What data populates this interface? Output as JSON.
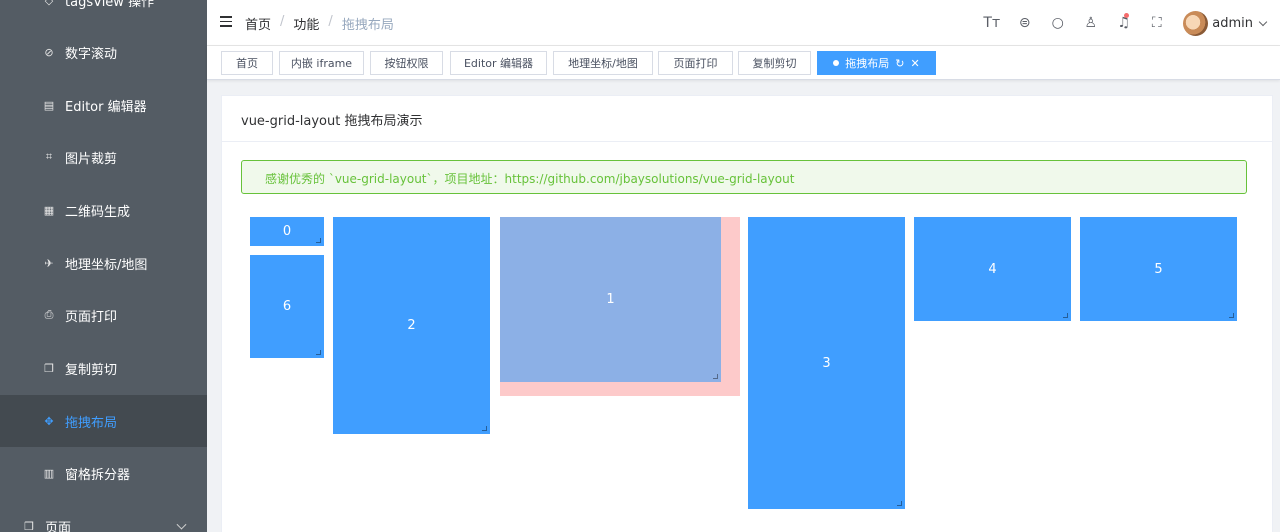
{
  "sidebar": {
    "items": [
      {
        "label": "tagsView 操作",
        "icon": "tag-icon"
      },
      {
        "label": "数字滚动",
        "icon": "gauge-icon"
      },
      {
        "label": "Editor 编辑器",
        "icon": "editor-icon"
      },
      {
        "label": "图片裁剪",
        "icon": "crop-icon"
      },
      {
        "label": "二维码生成",
        "icon": "qrcode-icon"
      },
      {
        "label": "地理坐标/地图",
        "icon": "map-icon"
      },
      {
        "label": "页面打印",
        "icon": "printer-icon"
      },
      {
        "label": "复制剪切",
        "icon": "copy-icon"
      },
      {
        "label": "拖拽布局",
        "icon": "drag-icon"
      },
      {
        "label": "窗格拆分器",
        "icon": "split-icon"
      },
      {
        "label": "页面",
        "icon": "page-icon"
      }
    ]
  },
  "navbar": {
    "breadcrumb": [
      "首页",
      "功能",
      "拖拽布局"
    ],
    "username": "admin"
  },
  "tags": [
    {
      "label": "首页"
    },
    {
      "label": "内嵌 iframe"
    },
    {
      "label": "按钮权限"
    },
    {
      "label": "Editor 编辑器"
    },
    {
      "label": "地理坐标/地图"
    },
    {
      "label": "页面打印"
    },
    {
      "label": "复制剪切"
    },
    {
      "label": "拖拽布局"
    }
  ],
  "card": {
    "title": "vue-grid-layout 拖拽布局演示",
    "alert": "感谢优秀的 `vue-grid-layout`，项目地址：https://github.com/jbaysolutions/vue-grid-layout"
  },
  "grid": {
    "items": [
      "0",
      "6",
      "2",
      "1",
      "3",
      "4",
      "5"
    ]
  },
  "colors": {
    "accent": "#409eff",
    "sidebar_bg": "#545c64",
    "placeholder": "#fdcaca",
    "success": "#67c23a"
  }
}
